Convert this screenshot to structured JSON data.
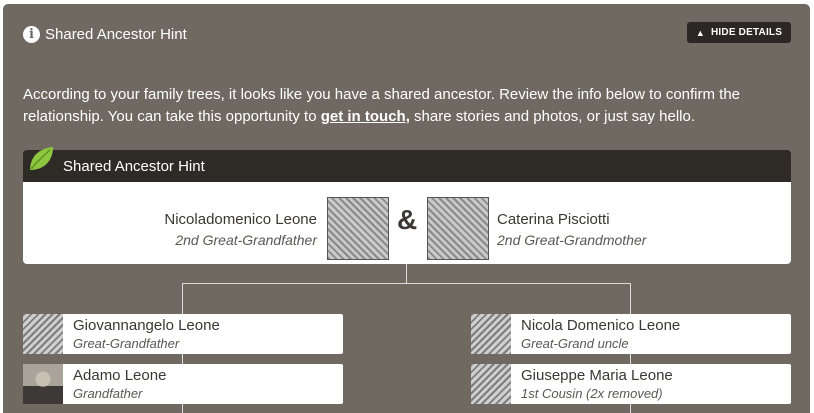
{
  "header": {
    "title": "Shared Ancestor Hint",
    "hide_details_label": "HIDE DETAILS"
  },
  "intro": {
    "text_before": "According to your family trees, it looks like you have a shared ancestor. Review the info below to confirm the relationship. You can take this opportunity to ",
    "link_text": "get in touch,",
    "text_after": " share stories and photos, or just say hello."
  },
  "hint_bar": {
    "title": "Shared Ancestor Hint"
  },
  "ancestors": {
    "left": {
      "name": "Nicoladomenico Leone",
      "relation": "2nd Great-Grandfather"
    },
    "ampersand": "&",
    "right": {
      "name": "Caterina Pisciotti",
      "relation": "2nd Great-Grandmother"
    }
  },
  "left_branch": [
    {
      "name": "Giovannangelo Leone",
      "relation": "Great-Grandfather"
    },
    {
      "name": "Adamo Leone",
      "relation": "Grandfather"
    }
  ],
  "right_branch": [
    {
      "name": "Nicola Domenico Leone",
      "relation": "Great-Grand uncle"
    },
    {
      "name": "Giuseppe Maria Leone",
      "relation": "1st Cousin (2x removed)"
    }
  ],
  "colors": {
    "panel_bg": "#6f6962",
    "bar_bg": "#2e2a26",
    "leaf": "#8dc63f"
  }
}
